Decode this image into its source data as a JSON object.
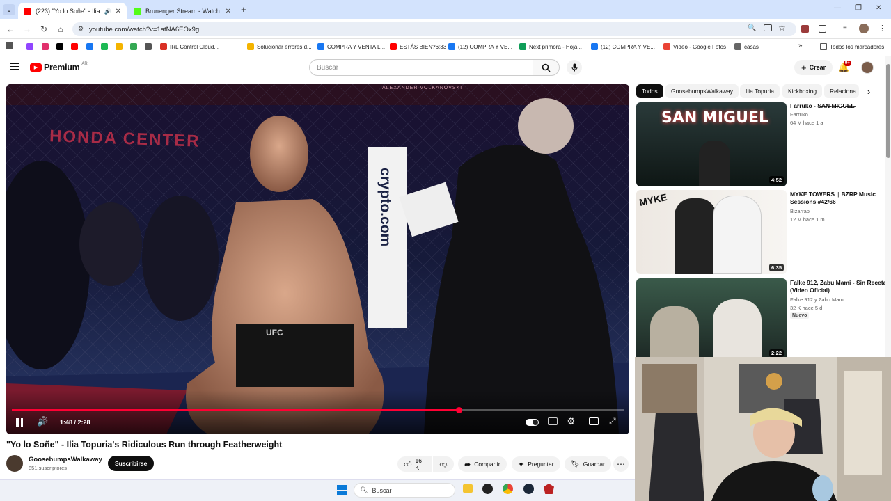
{
  "browser": {
    "tabs": [
      {
        "title": "(223) \"Yo lo Soñe\" - Ilia Topuria's...",
        "active": true,
        "favicon_color": "#ff0000"
      },
      {
        "title": "Brunenger Stream - Watch Live on Kick",
        "active": false,
        "favicon_color": "#53fc18"
      }
    ],
    "new_tab": "+",
    "url": "youtube.com/watch?v=1atNA6EOx9g",
    "window_controls": {
      "minimize": "—",
      "restore": "❐",
      "close": "✕"
    }
  },
  "bookmarks": [
    {
      "label": "",
      "color": "#9146ff"
    },
    {
      "label": "",
      "color": "#e1306c"
    },
    {
      "label": "",
      "color": "#000000"
    },
    {
      "label": "",
      "color": "#ff0000"
    },
    {
      "label": "",
      "color": "#1877f2"
    },
    {
      "label": "",
      "color": "#1db954"
    },
    {
      "label": "",
      "color": "#f4b400"
    },
    {
      "label": "",
      "color": "#34a853"
    },
    {
      "label": "",
      "color": "#555555"
    },
    {
      "label": "IRL Control Cloud...",
      "color": "#d93025"
    },
    {
      "label": "Solucionar errores d...",
      "color": "#f4b400"
    },
    {
      "label": "COMPRA Y VENTA L...",
      "color": "#1877f2"
    },
    {
      "label": "ESTÁS BIEN?6:33",
      "color": "#ff0000"
    },
    {
      "label": "(12) COMPRA Y VE...",
      "color": "#1877f2"
    },
    {
      "label": "Next primora - Hoja...",
      "color": "#0f9d58"
    },
    {
      "label": "(12) COMPRA Y VE...",
      "color": "#1877f2"
    },
    {
      "label": "Vídeo - Google Fotos",
      "color": "#ea4335"
    },
    {
      "label": "casas",
      "color": "#666666"
    }
  ],
  "bookmarks_all": "Todos los marcadores",
  "youtube": {
    "logo": "Premium",
    "logo_region": "AR",
    "search_placeholder": "Buscar",
    "create_label": "Crear",
    "notif_count": "9+"
  },
  "video": {
    "title": "\"Yo lo Soñe\" - Ilia Topuria's Ridiculous Run through Featherweight",
    "time": "1:48 / 2:28",
    "progress": 0.73,
    "channel": "GoosebumpsWalkaway",
    "subscribers": "851 suscriptores",
    "subscribe_label": "Suscribirse",
    "likes": "16 K",
    "share_label": "Compartir",
    "ask_label": "Preguntar",
    "save_label": "Guardar",
    "overlay": {
      "arena": "HONDA CENTER",
      "sponsor": "crypto.com",
      "shorts": "UFC",
      "banner": "ALEXANDER VOLKANOVSKI"
    }
  },
  "chips": [
    "Todos",
    "GoosebumpsWalkaway",
    "Ilia Topuria",
    "Kickboxing",
    "Relaciona"
  ],
  "related": [
    {
      "title": "Farruko - S̶A̶N̶ M̶I̶G̶U̶E̶L̶",
      "channel": "Farruko",
      "meta": "64 M  hace 1 a",
      "duration": "4:52",
      "thumb_text": "SAN MIGUEL",
      "badge": ""
    },
    {
      "title": "MYKE TOWERS || BZRP Music Sessions #42/66",
      "channel": "Bizarrap",
      "meta": "12 M  hace 1 m",
      "duration": "6:35",
      "thumb_text": "MYKE",
      "badge": ""
    },
    {
      "title": "Falke 912, Zabu Mami - Sin Receta (Video Oficial)",
      "channel": "Falke 912  y Zabu Mami",
      "meta": "32 K  hace 5 d",
      "duration": "2:22",
      "thumb_text": "",
      "badge": "Nuevo"
    }
  ],
  "taskbar": {
    "search_placeholder": "Buscar"
  }
}
